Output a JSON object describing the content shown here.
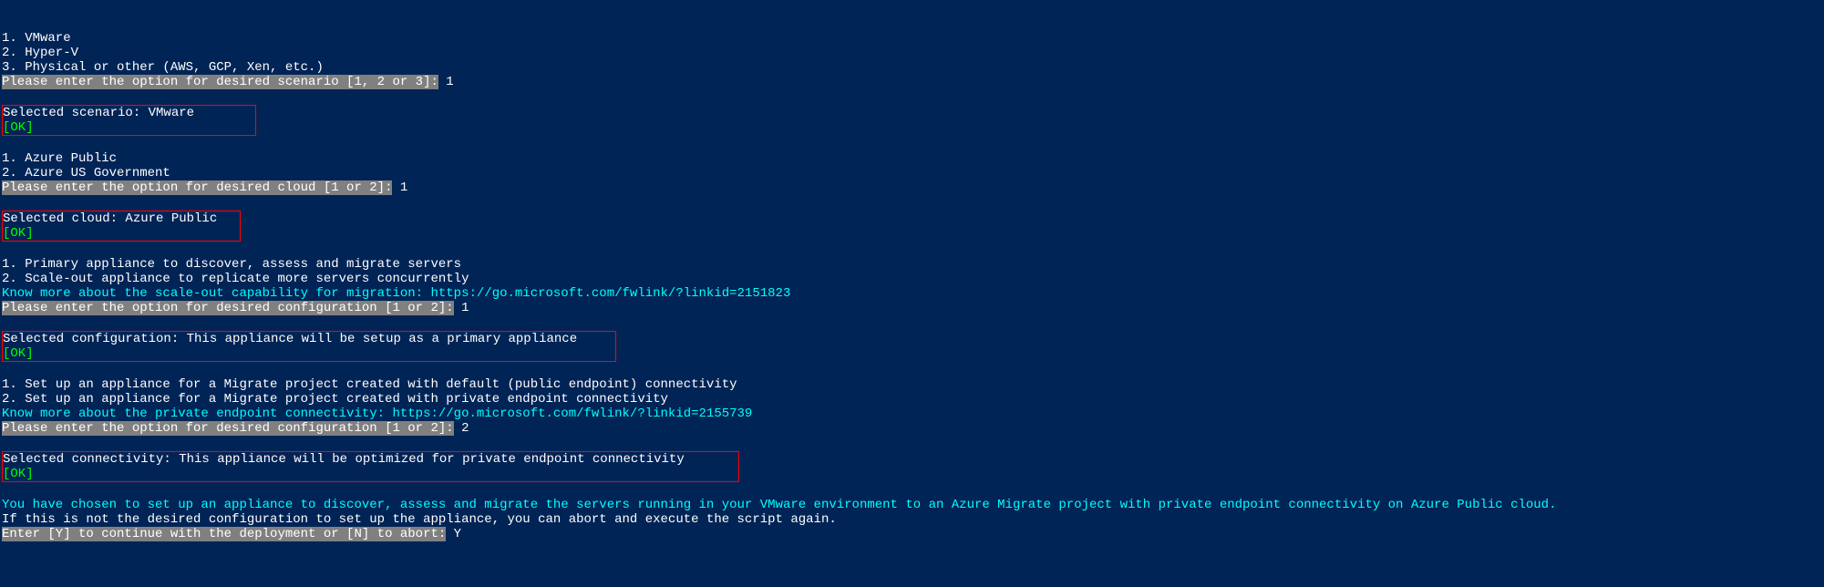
{
  "s1_opt1": "1. VMware",
  "s1_opt2": "2. Hyper-V",
  "s1_opt3": "3. Physical or other (AWS, GCP, Xen, etc.)",
  "s1_prompt": "Please enter the option for desired scenario [1, 2 or 3]:",
  "s1_input": " 1",
  "s1_selected": "Selected scenario: VMware",
  "ok": "[OK]",
  "s2_opt1": "1. Azure Public",
  "s2_opt2": "2. Azure US Government",
  "s2_prompt": "Please enter the option for desired cloud [1 or 2]:",
  "s2_input": " 1",
  "s2_selected": "Selected cloud: Azure Public",
  "s3_opt1": "1. Primary appliance to discover, assess and migrate servers",
  "s3_opt2": "2. Scale-out appliance to replicate more servers concurrently",
  "s3_link": "Know more about the scale-out capability for migration: https://go.microsoft.com/fwlink/?linkid=2151823",
  "s3_prompt": "Please enter the option for desired configuration [1 or 2]:",
  "s3_input": " 1",
  "s3_selected": "Selected configuration: This appliance will be setup as a primary appliance",
  "s4_opt1": "1. Set up an appliance for a Migrate project created with default (public endpoint) connectivity",
  "s4_opt2": "2. Set up an appliance for a Migrate project created with private endpoint connectivity",
  "s4_link": "Know more about the private endpoint connectivity: https://go.microsoft.com/fwlink/?linkid=2155739",
  "s4_prompt": "Please enter the option for desired configuration [1 or 2]:",
  "s4_input": " 2",
  "s4_selected": "Selected connectivity: This appliance will be optimized for private endpoint connectivity",
  "summary1": "You have chosen to set up an appliance to discover, assess and migrate the servers running in your VMware environment to an Azure Migrate project with private endpoint connectivity on Azure Public cloud.",
  "summary2": "If this is not the desired configuration to set up the appliance, you can abort and execute the script again.",
  "final_prompt": "Enter [Y] to continue with the deployment or [N] to abort:",
  "final_input": " Y"
}
